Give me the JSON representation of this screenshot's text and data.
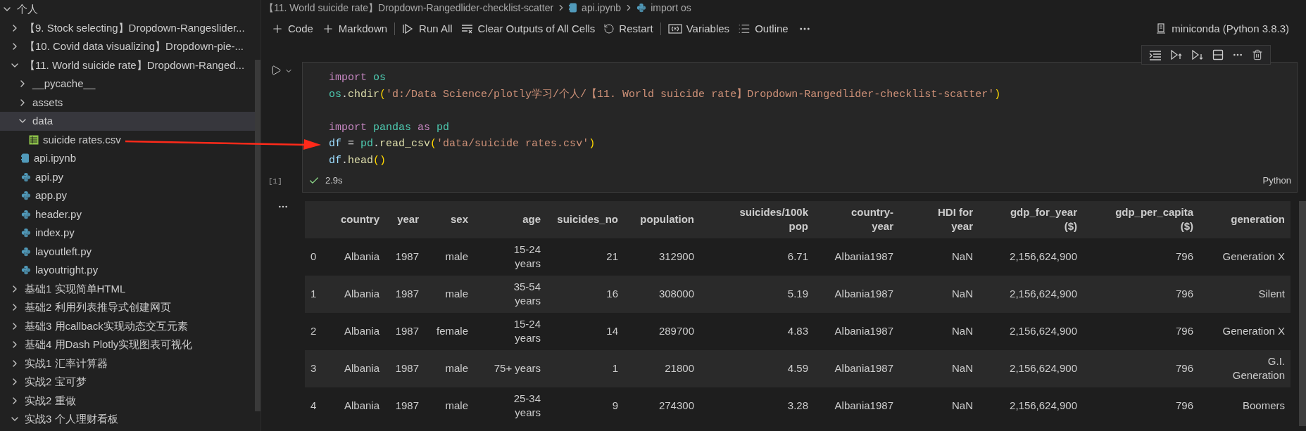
{
  "explorer": {
    "tree": [
      {
        "label": "个人",
        "kind": "folder",
        "expanded": true,
        "selected": false,
        "children": [
          {
            "label": "【9. Stock selecting】Dropdown-Rangeslider...",
            "kind": "folder",
            "expanded": false,
            "selected": false
          },
          {
            "label": "【10. Covid data visualizing】Dropdown-pie-...",
            "kind": "folder",
            "expanded": false,
            "selected": false
          },
          {
            "label": "【11. World suicide rate】Dropdown-Ranged...",
            "kind": "folder",
            "expanded": true,
            "selected": false,
            "children": [
              {
                "label": "__pycache__",
                "kind": "folder",
                "expanded": false,
                "selected": false
              },
              {
                "label": "assets",
                "kind": "folder",
                "expanded": false,
                "selected": false
              },
              {
                "label": "data",
                "kind": "folder",
                "expanded": true,
                "selected": true,
                "children": [
                  {
                    "label": "suicide rates.csv",
                    "kind": "csv",
                    "selected": false
                  }
                ]
              },
              {
                "label": "api.ipynb",
                "kind": "notebook",
                "selected": false
              },
              {
                "label": "api.py",
                "kind": "python",
                "selected": false
              },
              {
                "label": "app.py",
                "kind": "python",
                "selected": false
              },
              {
                "label": "header.py",
                "kind": "python",
                "selected": false
              },
              {
                "label": "index.py",
                "kind": "python",
                "selected": false
              },
              {
                "label": "layoutleft.py",
                "kind": "python",
                "selected": false
              },
              {
                "label": "layoutright.py",
                "kind": "python",
                "selected": false
              }
            ]
          },
          {
            "label": "基础1 实现简单HTML",
            "kind": "folder",
            "expanded": false,
            "selected": false
          },
          {
            "label": "基础2 利用列表推导式创建网页",
            "kind": "folder",
            "expanded": false,
            "selected": false
          },
          {
            "label": "基础3  用callback实现动态交互元素",
            "kind": "folder",
            "expanded": false,
            "selected": false
          },
          {
            "label": "基础4  用Dash Plotly实现图表可视化",
            "kind": "folder",
            "expanded": false,
            "selected": false
          },
          {
            "label": "实战1 汇率计算器",
            "kind": "folder",
            "expanded": false,
            "selected": false
          },
          {
            "label": "实战2 宝可梦",
            "kind": "folder",
            "expanded": false,
            "selected": false
          },
          {
            "label": "实战2 重做",
            "kind": "folder",
            "expanded": false,
            "selected": false
          },
          {
            "label": "实战3 个人理财看板",
            "kind": "folder",
            "expanded": true,
            "selected": false
          }
        ]
      }
    ]
  },
  "breadcrumb": [
    {
      "kind": "folder",
      "label": "【11. World suicide rate】Dropdown-Rangedlider-checklist-scatter"
    },
    {
      "kind": "notebook",
      "label": "api.ipynb"
    },
    {
      "kind": "python",
      "label": "import os"
    }
  ],
  "toolbar": {
    "items": [
      {
        "kind": "plus",
        "label": "Code",
        "separator_after": false
      },
      {
        "kind": "plus",
        "label": "Markdown",
        "separator_after": true
      },
      {
        "kind": "run-all",
        "label": "Run All",
        "separator_after": false
      },
      {
        "kind": "clear",
        "label": "Clear Outputs of All Cells",
        "separator_after": false
      },
      {
        "kind": "restart",
        "label": "Restart",
        "separator_after": true
      },
      {
        "kind": "variables",
        "label": "Variables",
        "separator_after": false
      },
      {
        "kind": "outline",
        "label": "Outline",
        "separator_after": false
      }
    ],
    "kernel": "miniconda (Python 3.8.3)"
  },
  "cell": {
    "execution_count": "[1]",
    "succeeded": true,
    "duration": "2.9s",
    "language": "Python",
    "lines": [
      {
        "kind": "code",
        "tokens": [
          {
            "kind": "keyword",
            "text": "import "
          },
          {
            "kind": "module",
            "text": "os"
          }
        ]
      },
      {
        "kind": "code",
        "tokens": [
          {
            "kind": "module",
            "text": "os"
          },
          {
            "kind": "plain",
            "text": "."
          },
          {
            "kind": "function",
            "text": "chdir"
          },
          {
            "kind": "paren",
            "text": "("
          },
          {
            "kind": "string",
            "text": "'d:/Data Science/plotly学习/个人/【11. World suicide rate】Dropdown-Rangedlider-checklist-scatter'"
          },
          {
            "kind": "paren",
            "text": ")"
          }
        ]
      },
      {
        "kind": "blank"
      },
      {
        "kind": "code",
        "tokens": [
          {
            "kind": "keyword",
            "text": "import "
          },
          {
            "kind": "module",
            "text": "pandas "
          },
          {
            "kind": "keyword",
            "text": "as "
          },
          {
            "kind": "module",
            "text": "pd"
          }
        ]
      },
      {
        "kind": "code",
        "tokens": [
          {
            "kind": "variable",
            "text": "df"
          },
          {
            "kind": "plain",
            "text": " = "
          },
          {
            "kind": "module",
            "text": "pd"
          },
          {
            "kind": "plain",
            "text": "."
          },
          {
            "kind": "function",
            "text": "read_csv"
          },
          {
            "kind": "paren",
            "text": "("
          },
          {
            "kind": "string",
            "text": "'data/suicide rates.csv'"
          },
          {
            "kind": "paren",
            "text": ")"
          }
        ]
      },
      {
        "kind": "code",
        "tokens": [
          {
            "kind": "variable",
            "text": "df"
          },
          {
            "kind": "plain",
            "text": "."
          },
          {
            "kind": "function",
            "text": "head"
          },
          {
            "kind": "paren",
            "text": "()"
          }
        ]
      }
    ]
  },
  "output": {
    "columns": [
      "country",
      "year",
      "sex",
      "age",
      "suicides_no",
      "population",
      "suicides/100k pop",
      "country-year",
      "HDI for year",
      "gdp_for_year ($)",
      "gdp_per_capita ($)",
      "generation"
    ],
    "rows": [
      {
        "index": "0",
        "cells": [
          "Albania",
          "1987",
          "male",
          "15-24 years",
          "21",
          "312900",
          "6.71",
          "Albania1987",
          "NaN",
          "2,156,624,900",
          "796",
          "Generation X"
        ]
      },
      {
        "index": "1",
        "cells": [
          "Albania",
          "1987",
          "male",
          "35-54 years",
          "16",
          "308000",
          "5.19",
          "Albania1987",
          "NaN",
          "2,156,624,900",
          "796",
          "Silent"
        ]
      },
      {
        "index": "2",
        "cells": [
          "Albania",
          "1987",
          "female",
          "15-24 years",
          "14",
          "289700",
          "4.83",
          "Albania1987",
          "NaN",
          "2,156,624,900",
          "796",
          "Generation X"
        ]
      },
      {
        "index": "3",
        "cells": [
          "Albania",
          "1987",
          "male",
          "75+ years",
          "1",
          "21800",
          "4.59",
          "Albania1987",
          "NaN",
          "2,156,624,900",
          "796",
          "G.I. Generation"
        ]
      },
      {
        "index": "4",
        "cells": [
          "Albania",
          "1987",
          "male",
          "25-34 years",
          "9",
          "274300",
          "3.28",
          "Albania1987",
          "NaN",
          "2,156,624,900",
          "796",
          "Boomers"
        ]
      }
    ]
  }
}
